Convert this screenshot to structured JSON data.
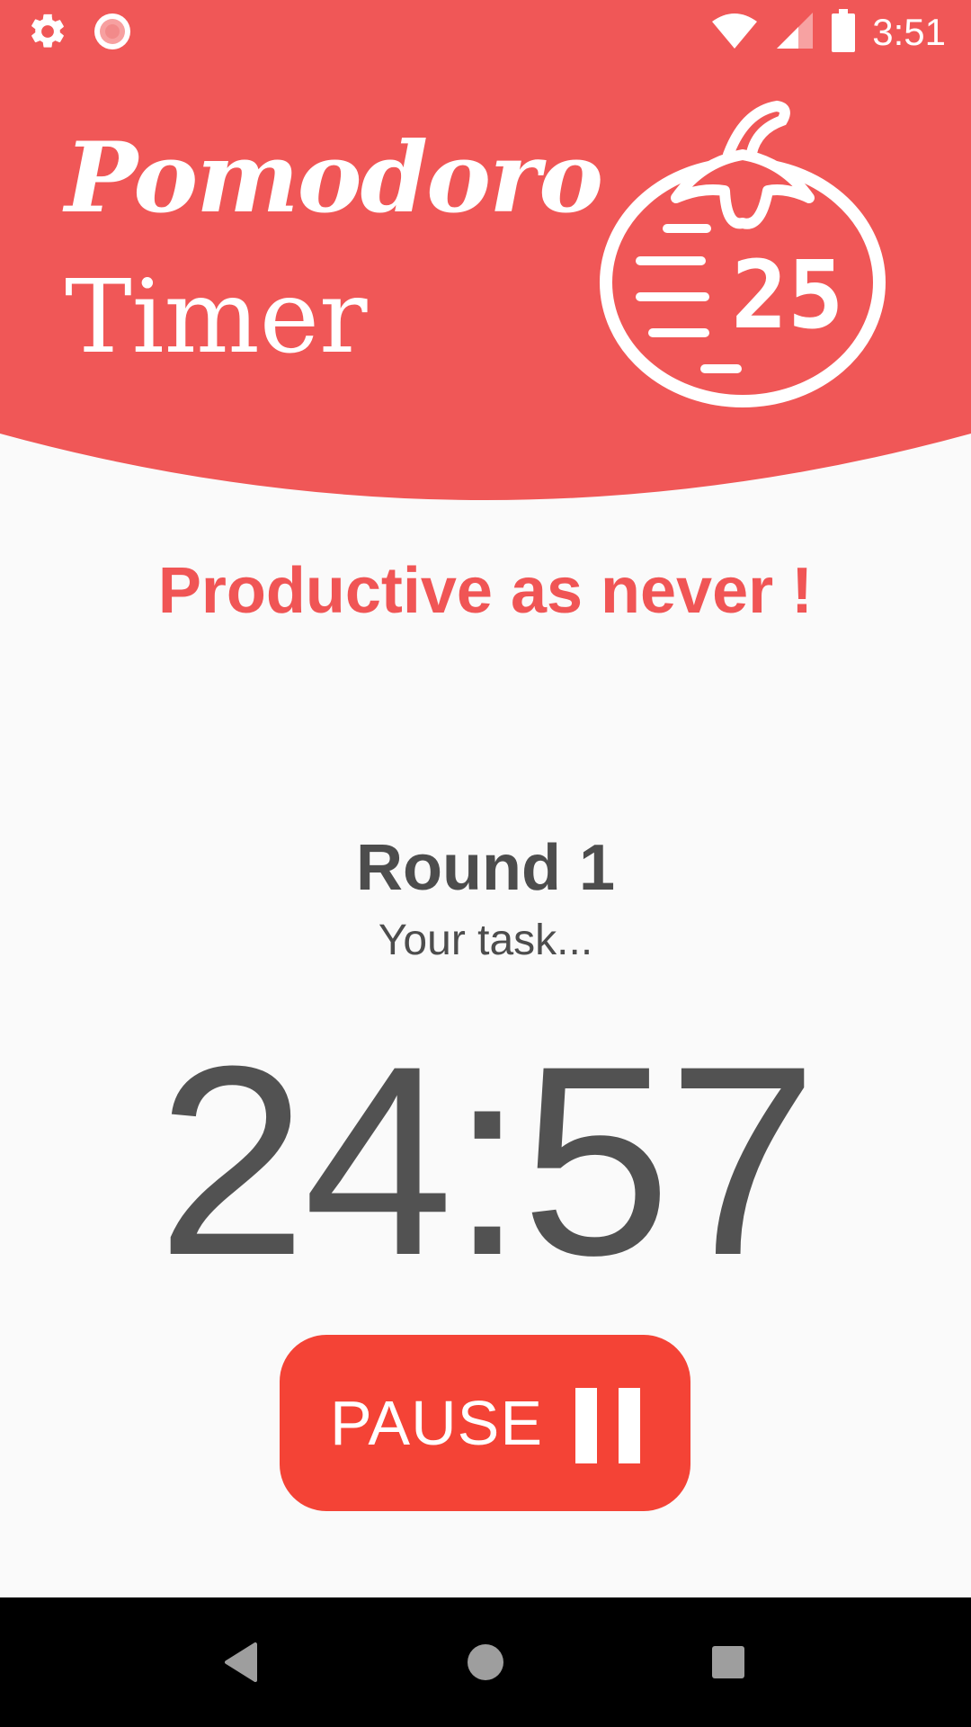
{
  "theme": {
    "header_color": "#f05757",
    "accent_color": "#f44336",
    "tagline_color": "#f05555",
    "text_color": "#4d4d4d",
    "background": "#fafafa"
  },
  "status_bar": {
    "left_icons": [
      "settings-gear-icon",
      "loading-spinner-icon"
    ],
    "right_icons": [
      "wifi-icon",
      "cell-signal-icon",
      "battery-icon"
    ],
    "time": "3:51"
  },
  "header": {
    "title_script": "Pomodoro",
    "title_sub": "Timer",
    "logo_number": "25",
    "logo_icon": "tomato-timer-logo-icon"
  },
  "main": {
    "tagline": "Productive as never !",
    "round_label": "Round 1",
    "task_label": "Your task...",
    "timer_value": "24:57"
  },
  "controls": {
    "pause_label": "PAUSE",
    "pause_icon": "pause-icon"
  },
  "nav_bar": {
    "buttons": [
      "back-icon",
      "home-icon",
      "recents-icon"
    ]
  }
}
